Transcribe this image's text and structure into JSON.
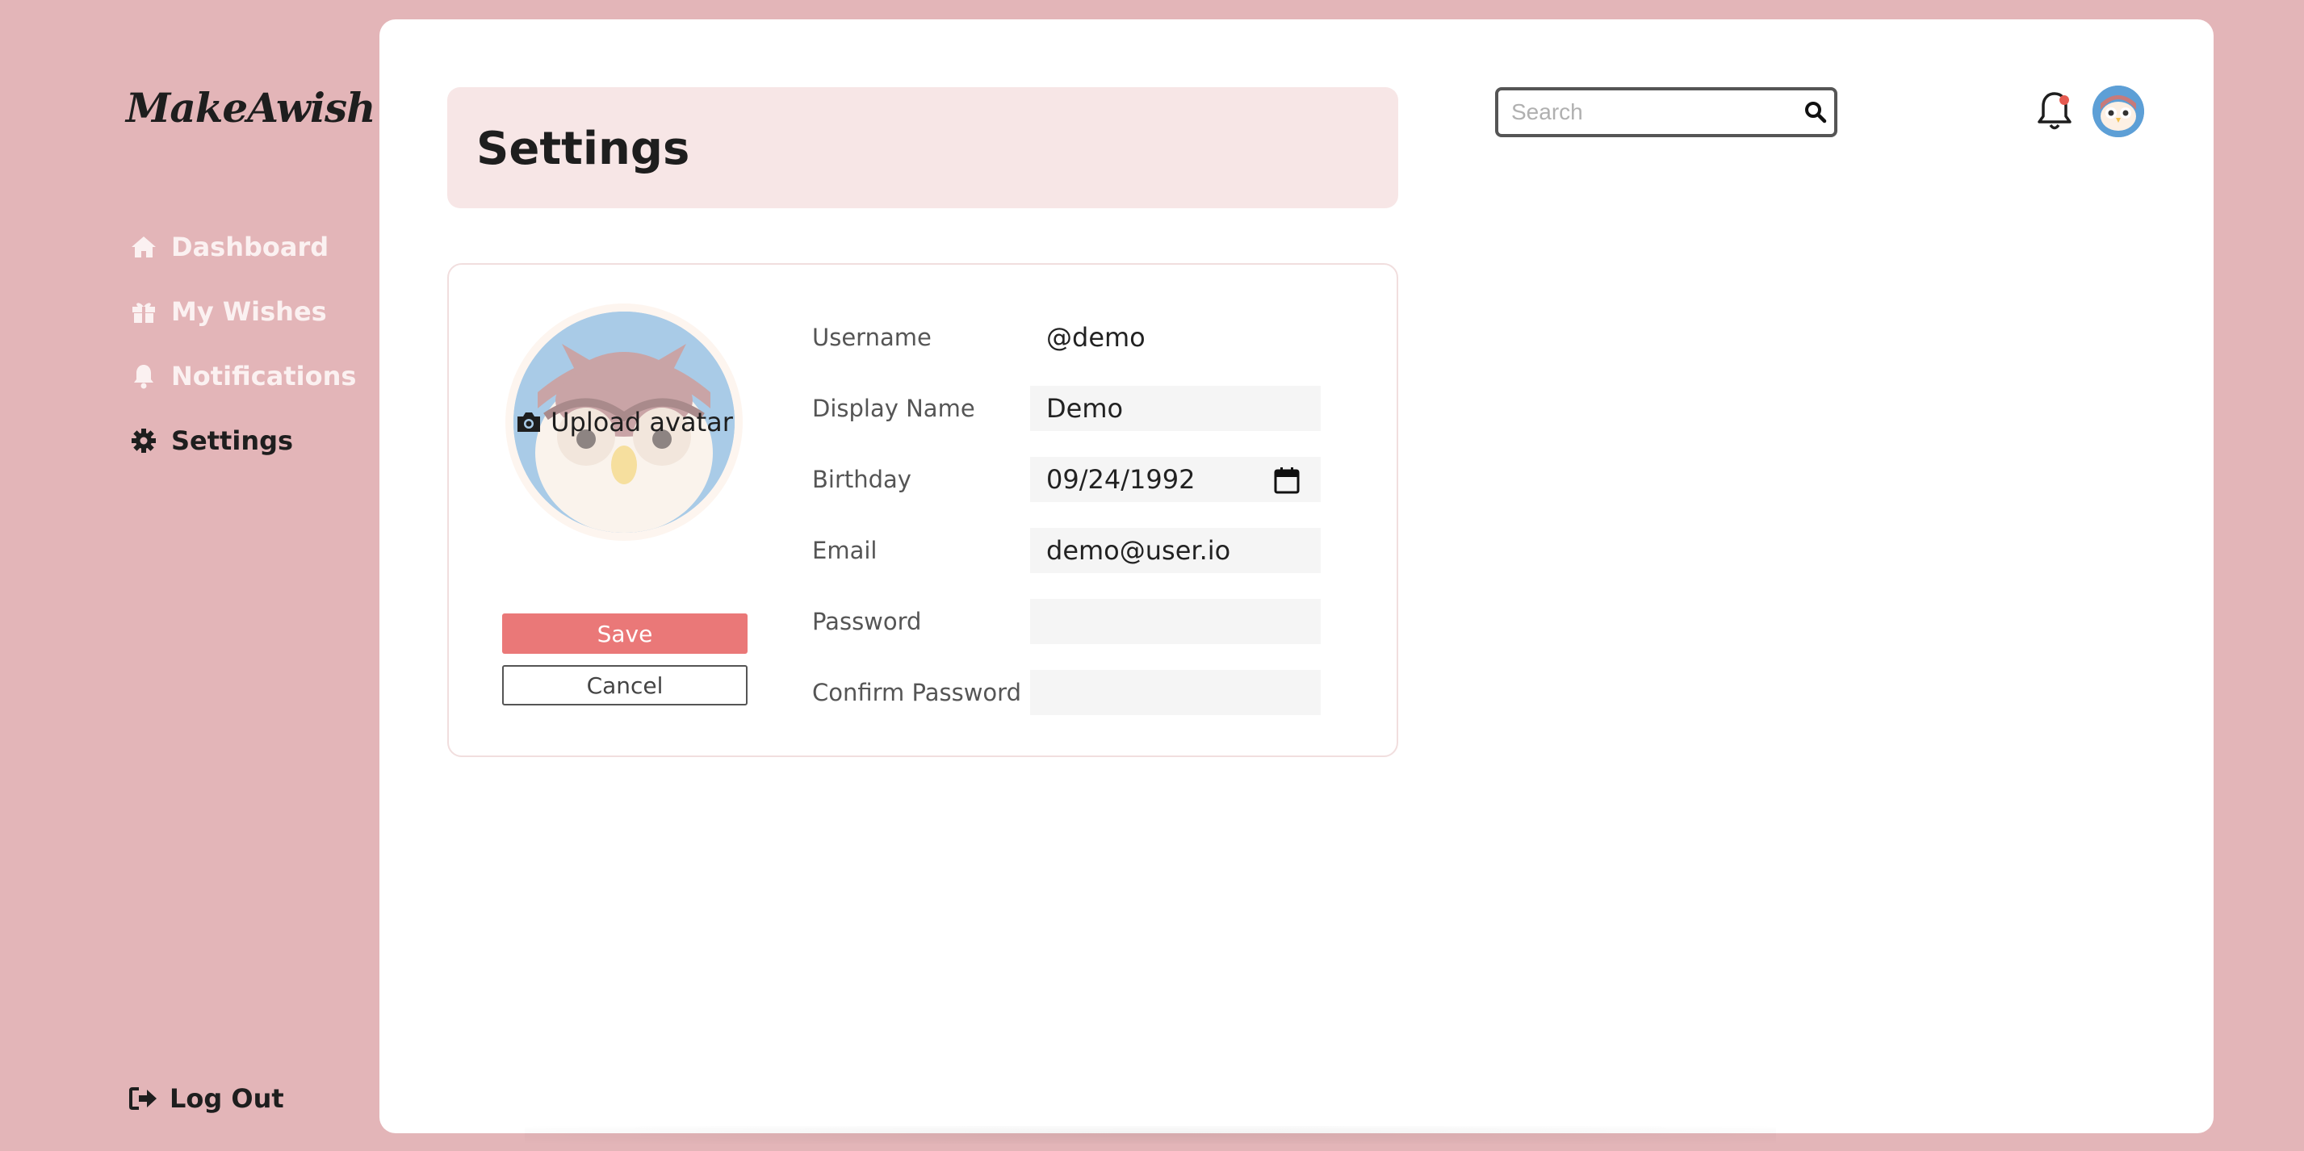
{
  "brand": {
    "logo_text": "MakeAwish"
  },
  "sidebar": {
    "items": [
      {
        "label": "Dashboard",
        "icon": "home-icon"
      },
      {
        "label": "My Wishes",
        "icon": "gift-icon"
      },
      {
        "label": "Notifications",
        "icon": "bell-icon"
      },
      {
        "label": "Settings",
        "icon": "gear-icon",
        "active": true
      }
    ],
    "logout_label": "Log Out"
  },
  "header": {
    "title": "Settings",
    "search_placeholder": "Search",
    "notification_dot": true
  },
  "profile": {
    "upload_label": "Upload avatar",
    "save_label": "Save",
    "cancel_label": "Cancel",
    "fields": {
      "username": {
        "label": "Username",
        "value": "@demo"
      },
      "display_name": {
        "label": "Display Name",
        "value": "Demo"
      },
      "birthday": {
        "label": "Birthday",
        "value": "09/24/1992"
      },
      "email": {
        "label": "Email",
        "value": "demo@user.io"
      },
      "password": {
        "label": "Password",
        "value": ""
      },
      "confirm_password": {
        "label": "Confirm Password",
        "value": ""
      }
    }
  },
  "colors": {
    "page_bg": "#e3b5b8",
    "accent": "#ea7878",
    "header_bg": "#f7e6e6",
    "sidebar_text": "#fbf1f1",
    "active_text": "#1e1e1e",
    "notification_dot": "#e65a50"
  }
}
